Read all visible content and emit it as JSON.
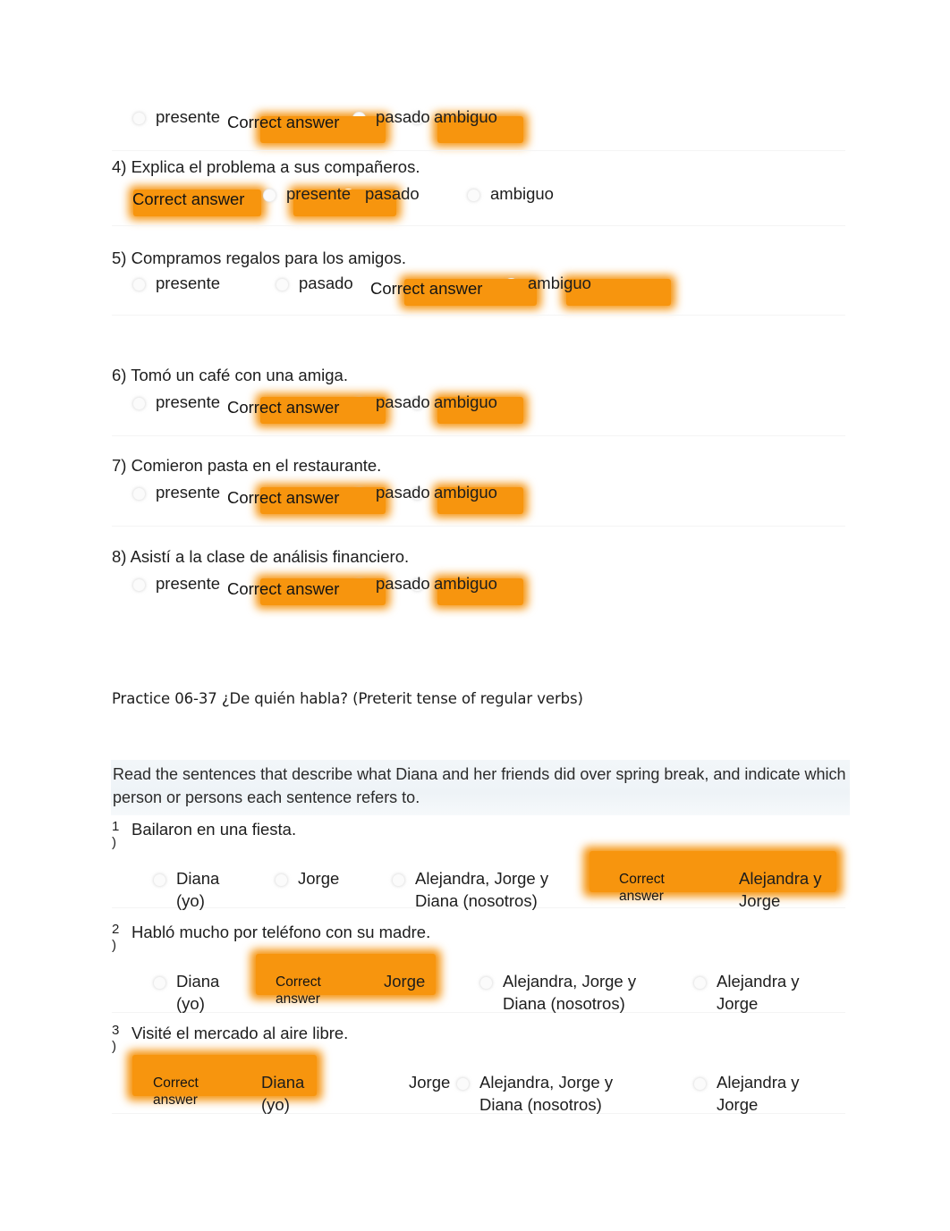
{
  "document": {
    "background": "#ffffff",
    "accent_orange": "#f5920b",
    "correct_answer_label": "Correct answer"
  },
  "section1": {
    "questions": [
      {
        "number": "",
        "stem": "",
        "partial_top": true,
        "options": [
          "presente",
          "pasado",
          "ambiguo"
        ],
        "correct_index": 1
      },
      {
        "number": "4)",
        "stem": "4) Explica el problema a sus compañeros.",
        "options": [
          "presente",
          "pasado",
          "ambiguo"
        ],
        "correct_index": 0
      },
      {
        "number": "5)",
        "stem": "5) Compramos regalos para los amigos.",
        "options": [
          "presente",
          "pasado",
          "ambiguo"
        ],
        "correct_index": 2
      },
      {
        "number": "6)",
        "stem": "6) Tomó un café con una amiga.",
        "options": [
          "presente",
          "pasado",
          "ambiguo"
        ],
        "correct_index": 1
      },
      {
        "number": "7)",
        "stem": "7) Comieron pasta en el restaurante.",
        "options": [
          "presente",
          "pasado",
          "ambiguo"
        ],
        "correct_index": 1
      },
      {
        "number": "8)",
        "stem": "8) Asistí a la clase de análisis financiero.",
        "options": [
          "presente",
          "pasado",
          "ambiguo"
        ],
        "correct_index": 1
      }
    ]
  },
  "section2": {
    "heading": "Practice 06-37 ¿De quién habla? (Preterit tense of regular verbs)",
    "instructions": "Read the sentences that describe what Diana and her friends did over spring break, and indicate which person or persons each sentence refers to.",
    "questions": [
      {
        "number": "1",
        "paren": ")",
        "stem": "Bailaron en una fiesta.",
        "options": [
          "Diana\n(yo)",
          "Jorge",
          "Alejandra, Jorge y\nDiana (nosotros)",
          "Alejandra y\nJorge"
        ],
        "correct_index": 3
      },
      {
        "number": "2",
        "paren": ")",
        "stem": "Habló mucho por teléfono con su madre.",
        "options": [
          "Diana\n(yo)",
          "Jorge",
          "Alejandra, Jorge y\nDiana (nosotros)",
          "Alejandra y\nJorge"
        ],
        "correct_index": 1
      },
      {
        "number": "3",
        "paren": ")",
        "stem": "Visité el mercado al aire libre.",
        "options": [
          "Diana\n(yo)",
          "Jorge",
          "Alejandra, Jorge y\nDiana (nosotros)",
          "Alejandra y\nJorge"
        ],
        "correct_index": 0
      }
    ]
  }
}
